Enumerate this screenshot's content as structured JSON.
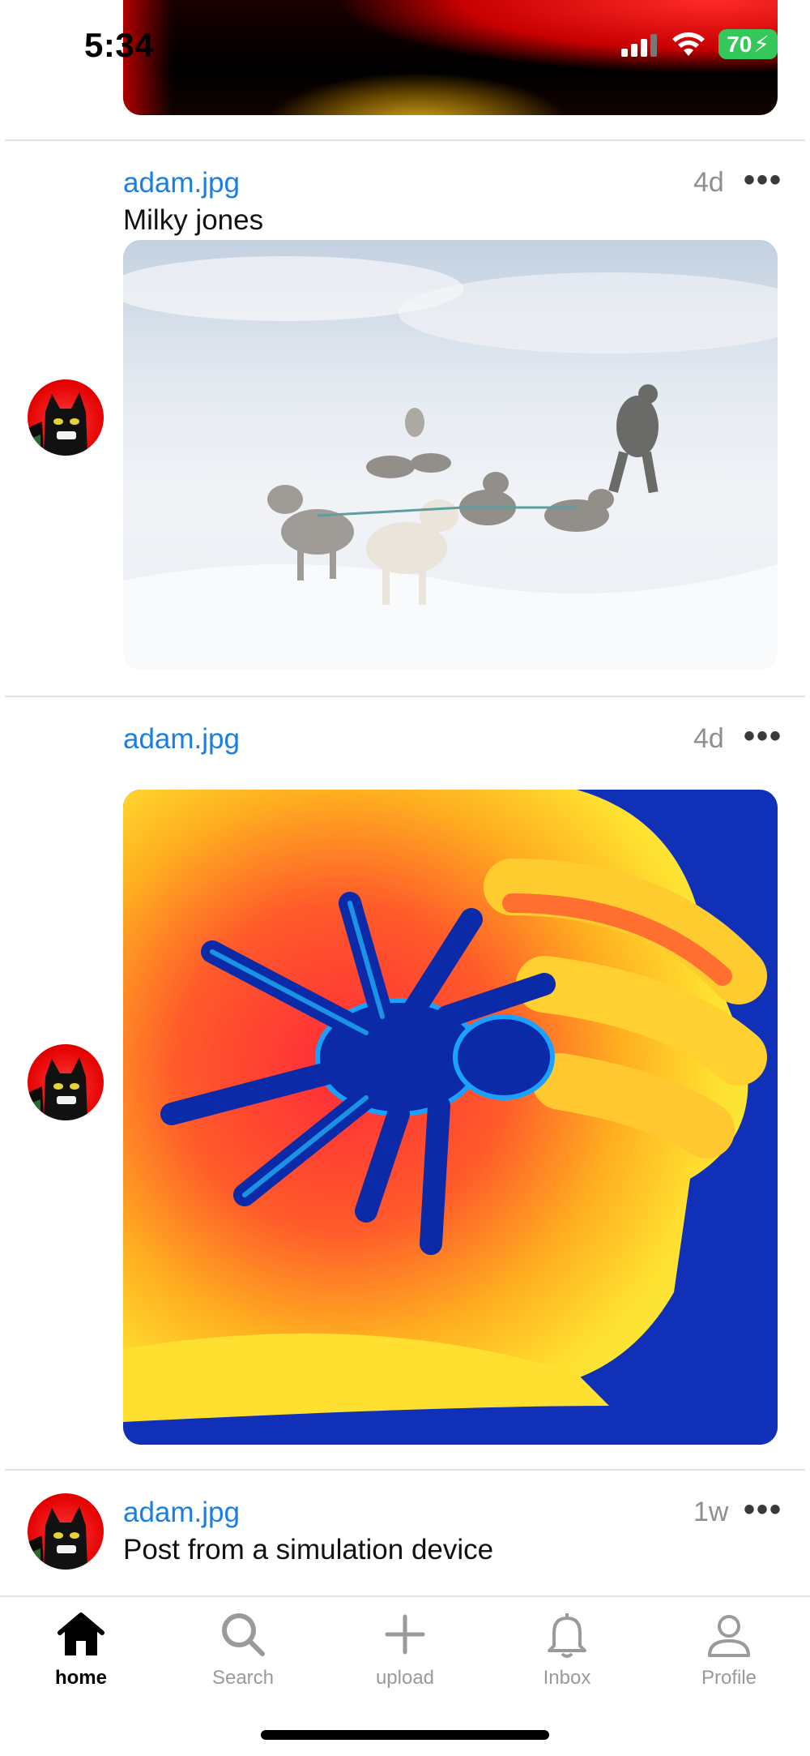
{
  "status": {
    "time": "5:34",
    "battery": "70"
  },
  "posts": [
    {
      "author": "adam.jpg",
      "caption": "Milky jones",
      "time": "4d",
      "more": "•••",
      "image_icon": "sled-dogs-snow-photo"
    },
    {
      "author": "adam.jpg",
      "caption": "",
      "time": "4d",
      "more": "•••",
      "image_icon": "thermal-spider-hand-photo"
    },
    {
      "author": "adam.jpg",
      "caption": "Post from a simulation device",
      "time": "1w",
      "more": "•••"
    }
  ],
  "tabs": [
    {
      "label": "home",
      "icon": "home-icon",
      "active": true
    },
    {
      "label": "Search",
      "icon": "search-icon",
      "active": false
    },
    {
      "label": "upload",
      "icon": "plus-icon",
      "active": false
    },
    {
      "label": "Inbox",
      "icon": "bell-icon",
      "active": false
    },
    {
      "label": "Profile",
      "icon": "person-icon",
      "active": false
    }
  ],
  "colors": {
    "accent": "#1a7fe0",
    "muted": "#8e8e93",
    "battery": "#34c759"
  }
}
